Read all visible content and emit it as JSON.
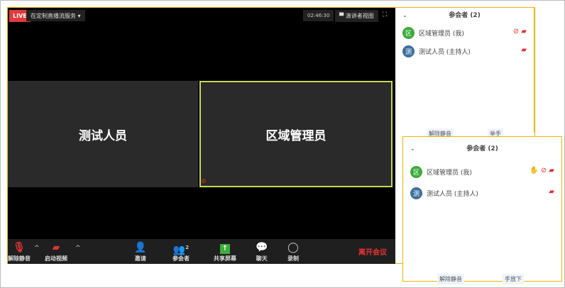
{
  "header": {
    "live": "LIVE",
    "stream_title": "在定制直播流服务 ▾",
    "timer": "02:46:30",
    "speaker_view": "演讲者视图",
    "fullscreen_icon": "⛶"
  },
  "tiles": [
    {
      "name": "测试人员"
    },
    {
      "name": "区域管理员"
    }
  ],
  "toolbar": {
    "unmute": "解除静音",
    "start_video": "启动视频",
    "invite": "邀请",
    "participants": "参会者",
    "participants_count": "2",
    "share": "共享屏幕",
    "chat": "聊天",
    "record": "录制",
    "leave": "离开会议"
  },
  "panel1": {
    "title": "参会者 (2)",
    "participants": [
      {
        "avatar": "区",
        "name": "区域管理员 (我)",
        "color": "#3aaa3a"
      },
      {
        "avatar": "测",
        "name": "测试人员 (主持人)",
        "color": "#3d6f9e"
      }
    ],
    "unmute": "解除静音",
    "raise_hand": "举手"
  },
  "panel2": {
    "title": "参会者 (2)",
    "participants": [
      {
        "avatar": "区",
        "name": "区域管理员 (我)"
      },
      {
        "avatar": "测",
        "name": "测试人员 (主持人)"
      }
    ],
    "unmute": "解除静音",
    "lower_hand": "手放下"
  }
}
